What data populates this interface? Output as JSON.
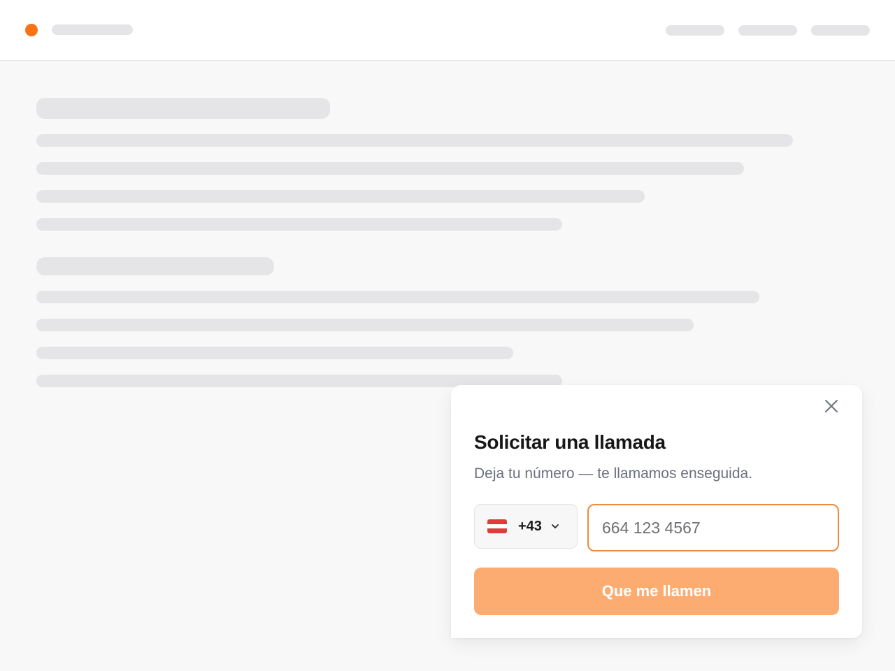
{
  "colors": {
    "brand_dot": "#f97316",
    "skeleton": "#e5e5e7",
    "input_focus_border": "#f08a3c",
    "submit_button_bg": "#fdac71"
  },
  "icons": {
    "close": "close-icon",
    "country_flag": "austria-flag-icon",
    "dropdown": "chevron-down-icon"
  },
  "callback_popup": {
    "title": "Solicitar una llamada",
    "subtitle": "Deja tu número — te llamamos enseguida.",
    "country_code": "+43",
    "phone_input": {
      "value": "",
      "placeholder": "664 123 4567"
    },
    "submit_label": "Que me llamen"
  }
}
